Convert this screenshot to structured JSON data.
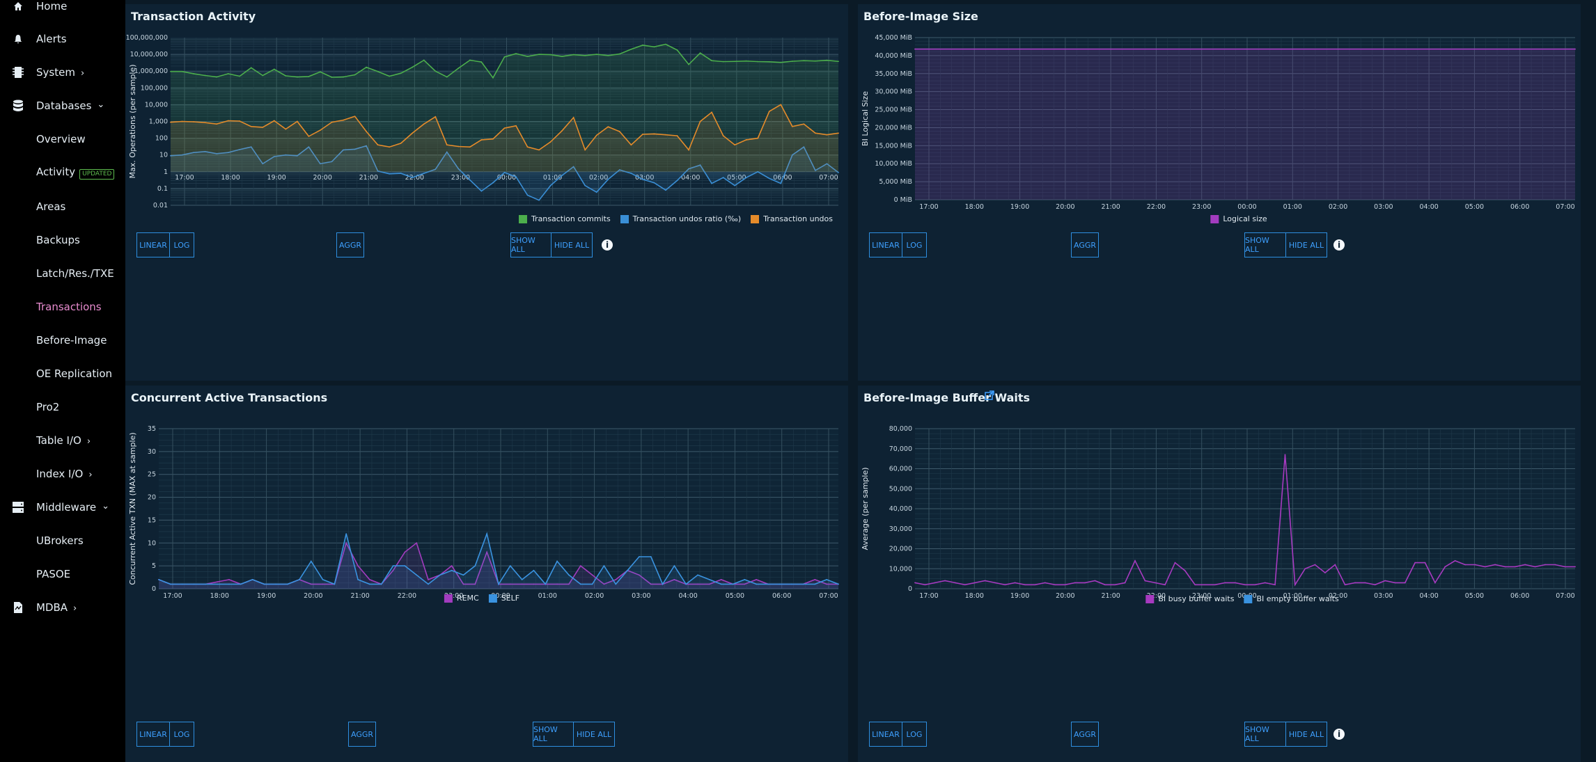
{
  "sidebar": {
    "items": [
      {
        "label": "Home",
        "icon": "home-icon",
        "chev": "",
        "active": false
      },
      {
        "label": "Alerts",
        "icon": "bell-icon",
        "chev": "",
        "active": false
      },
      {
        "label": "System",
        "icon": "chip-icon",
        "chev": "›",
        "active": false
      },
      {
        "label": "Databases",
        "icon": "database-icon",
        "chev": "⌄",
        "active": false
      },
      {
        "label": "Overview",
        "icon": "",
        "chev": "",
        "active": false
      },
      {
        "label": "Activity",
        "icon": "",
        "chev": "",
        "active": false,
        "badge": "UPDATED"
      },
      {
        "label": "Areas",
        "icon": "",
        "chev": "",
        "active": false
      },
      {
        "label": "Backups",
        "icon": "",
        "chev": "",
        "active": false
      },
      {
        "label": "Latch/Res./TXE",
        "icon": "",
        "chev": "",
        "active": false
      },
      {
        "label": "Transactions",
        "icon": "",
        "chev": "",
        "active": true
      },
      {
        "label": "Before-Image",
        "icon": "",
        "chev": "",
        "active": false
      },
      {
        "label": "OE Replication",
        "icon": "",
        "chev": "",
        "active": false
      },
      {
        "label": "Pro2",
        "icon": "",
        "chev": "",
        "active": false
      },
      {
        "label": "Table I/O",
        "icon": "",
        "chev": "›",
        "active": false
      },
      {
        "label": "Index I/O",
        "icon": "",
        "chev": "›",
        "active": false
      },
      {
        "label": "Middleware",
        "icon": "server-icon",
        "chev": "⌄",
        "active": false
      },
      {
        "label": "UBrokers",
        "icon": "",
        "chev": "",
        "active": false
      },
      {
        "label": "PASOE",
        "icon": "",
        "chev": "",
        "active": false
      },
      {
        "label": "MDBA",
        "icon": "document-icon",
        "chev": "›",
        "active": false
      }
    ]
  },
  "buttons": {
    "linear": "LINEAR",
    "log": "LOG",
    "aggr": "AGGR",
    "show_all": "SHOW ALL",
    "hide_all": "HIDE ALL",
    "info": "i"
  },
  "panels": {
    "transaction_activity": {
      "title": "Transaction Activity"
    },
    "bi_size": {
      "title": "Before-Image Size"
    },
    "concurrent": {
      "title": "Concurrent Active Transactions"
    },
    "bi_buffer_waits": {
      "title": "Before-Image Buffer Waits"
    }
  },
  "colors": {
    "green": "#4cae4c",
    "blue": "#3a8fd6",
    "orange": "#e58b2a",
    "purple": "#a23cbf",
    "blue2": "#3a93e0",
    "purple2": "#a73ac0"
  },
  "chart_data": [
    {
      "id": "transaction_activity",
      "type": "line",
      "title": "Transaction Activity",
      "ylabel": "Max. Operations (per sample)",
      "yscale": "log",
      "ylim": [
        0.01,
        100000000
      ],
      "y_ticks": [
        "100,000,000",
        "10,000,000",
        "1,000,000",
        "100,000",
        "10,000",
        "1,000",
        "100",
        "10",
        "1",
        "0.1",
        "0.01"
      ],
      "x_ticks": [
        "17:00",
        "18:00",
        "19:00",
        "20:00",
        "21:00",
        "22:00",
        "23:00",
        "00:00",
        "01:00",
        "02:00",
        "03:00",
        "04:00",
        "05:00",
        "06:00",
        "07:00"
      ],
      "grid": true,
      "legend": "bottom-right",
      "series": [
        {
          "name": "Transaction commits",
          "color": "#4cae4c",
          "values": [
            950000,
            950000,
            700000,
            550000,
            450000,
            700000,
            500000,
            1600000,
            550000,
            1300000,
            520000,
            450000,
            480000,
            900000,
            430000,
            450000,
            600000,
            1700000,
            950000,
            500000,
            750000,
            1700000,
            4500000,
            1000000,
            450000,
            1500000,
            4500000,
            3500000,
            400000,
            7000000,
            11000000,
            7500000,
            10000000,
            9500000,
            7500000,
            9500000,
            8500000,
            10000000,
            8500000,
            10500000,
            20000000,
            35000000,
            28000000,
            40000000,
            18000000,
            2500000,
            12000000,
            4200000,
            3700000,
            3800000,
            4000000,
            3700000,
            3600000,
            3300000,
            3900000,
            4200000,
            4000000,
            4400000,
            3800000
          ]
        },
        {
          "name": "Transaction undos ratio (‰)",
          "color": "#3a8fd6",
          "values": [
            9,
            10,
            14,
            16,
            12,
            14,
            21,
            30,
            3,
            8,
            10,
            9,
            30,
            3,
            4,
            20,
            22,
            35,
            1.1,
            0.75,
            0.8,
            0.45,
            0.8,
            1.4,
            15,
            1.5,
            0.32,
            0.07,
            0.22,
            0.9,
            0.5,
            0.04,
            0.02,
            0.15,
            0.6,
            2,
            0.15,
            0.06,
            0.35,
            1.3,
            0.8,
            0.35,
            0.22,
            0.08,
            0.3,
            1.5,
            2.5,
            0.2,
            0.45,
            0.15,
            0.45,
            1,
            0.4,
            0.2,
            10,
            30,
            1.2,
            3,
            0.9
          ]
        },
        {
          "name": "Transaction undos",
          "color": "#e58b2a",
          "values": [
            900,
            1000,
            950,
            850,
            700,
            1100,
            1050,
            500,
            450,
            1100,
            350,
            1000,
            130,
            300,
            900,
            1200,
            2000,
            250,
            40,
            30,
            50,
            200,
            700,
            1900,
            40,
            32,
            30,
            80,
            90,
            400,
            550,
            30,
            20,
            60,
            280,
            1700,
            20,
            150,
            480,
            250,
            40,
            170,
            180,
            160,
            140,
            20,
            1000,
            3500,
            140,
            40,
            80,
            100,
            4000,
            10000,
            500,
            700,
            200,
            160,
            200
          ]
        }
      ]
    },
    {
      "id": "bi_size",
      "type": "line",
      "title": "Before-Image Size",
      "ylabel": "BI Logical Size",
      "ylim": [
        0,
        45000
      ],
      "y_ticks": [
        "45,000 MiB",
        "40,000 MiB",
        "35,000 MiB",
        "30,000 MiB",
        "25,000 MiB",
        "20,000 MiB",
        "15,000 MiB",
        "10,000 MiB",
        "5,000 MiB",
        "0 MiB"
      ],
      "x_ticks": [
        "17:00",
        "18:00",
        "19:00",
        "20:00",
        "21:00",
        "22:00",
        "23:00",
        "00:00",
        "01:00",
        "02:00",
        "03:00",
        "04:00",
        "05:00",
        "06:00",
        "07:00"
      ],
      "grid": true,
      "legend": "bottom-right",
      "series": [
        {
          "name": "Logical size",
          "color": "#a23cbf",
          "values": [
            41800,
            41800
          ]
        }
      ]
    },
    {
      "id": "concurrent",
      "type": "line",
      "title": "Concurrent Active Transactions",
      "ylabel": "Concurrent Active TXN (MAX at sample)",
      "ylim": [
        0,
        35
      ],
      "y_ticks": [
        "35",
        "30",
        "25",
        "20",
        "15",
        "10",
        "5",
        "0"
      ],
      "x_ticks": [
        "17:00",
        "18:00",
        "19:00",
        "20:00",
        "21:00",
        "22:00",
        "23:00",
        "00:00",
        "01:00",
        "02:00",
        "03:00",
        "04:00",
        "05:00",
        "06:00",
        "07:00"
      ],
      "grid": true,
      "legend": "bottom-center",
      "series": [
        {
          "name": "REMC",
          "color": "#a23cbf",
          "values": [
            2,
            1,
            1,
            1,
            1,
            1.5,
            2,
            1,
            2,
            1,
            1,
            1,
            2,
            1,
            1,
            1,
            10,
            5,
            2,
            1,
            4,
            8,
            10,
            2,
            3,
            5,
            1,
            1,
            8,
            1,
            1,
            1,
            1,
            1,
            1,
            1,
            5,
            3,
            1,
            2,
            4,
            3,
            1,
            1,
            2,
            1,
            1,
            1,
            2,
            1,
            1,
            2,
            1,
            1,
            1,
            1,
            2,
            1,
            1
          ]
        },
        {
          "name": "SELF",
          "color": "#3a93e0",
          "values": [
            2,
            1,
            1,
            1,
            1,
            1,
            1,
            1,
            2,
            1,
            1,
            1,
            2,
            6,
            2,
            1,
            12,
            2,
            1,
            1,
            5,
            5,
            3,
            1,
            3,
            4,
            3,
            5,
            12,
            1,
            5,
            2,
            4,
            1,
            6,
            3,
            1,
            1,
            5,
            1,
            4,
            7,
            7,
            1,
            5,
            1,
            3,
            2,
            1,
            1,
            2,
            1,
            1,
            1,
            1,
            1,
            1,
            2,
            1
          ]
        }
      ]
    },
    {
      "id": "bi_buffer_waits",
      "type": "line",
      "title": "Before-Image Buffer Waits",
      "ylabel": "Average (per sample)",
      "ylim": [
        0,
        80000
      ],
      "y_ticks": [
        "80,000",
        "70,000",
        "60,000",
        "50,000",
        "40,000",
        "30,000",
        "20,000",
        "10,000",
        "0"
      ],
      "x_ticks": [
        "17:00",
        "18:00",
        "19:00",
        "20:00",
        "21:00",
        "22:00",
        "23:00",
        "00:00",
        "01:00",
        "02:00",
        "03:00",
        "04:00",
        "05:00",
        "06:00",
        "07:00"
      ],
      "grid": true,
      "legend": "bottom-center",
      "series": [
        {
          "name": "BI busy buffer waits",
          "color": "#a73ac0",
          "values": [
            3000,
            2000,
            3000,
            4000,
            3000,
            2000,
            3000,
            4000,
            3000,
            2000,
            3000,
            2000,
            2000,
            3000,
            2000,
            2000,
            3000,
            3000,
            4000,
            2000,
            2000,
            3000,
            14000,
            4000,
            3000,
            2000,
            13000,
            9000,
            2000,
            2000,
            2000,
            3000,
            3000,
            2000,
            2000,
            3000,
            2000,
            67000,
            2000,
            10000,
            12000,
            8000,
            12000,
            2000,
            3000,
            3000,
            2000,
            4000,
            3000,
            3000,
            13000,
            13000,
            3000,
            11000,
            14000,
            12000,
            12000,
            11000,
            12000,
            11000,
            11000,
            12000,
            11000,
            12000,
            12000,
            11000,
            11000
          ]
        },
        {
          "name": "BI empty buffer waits",
          "color": "#3a93e0",
          "values": []
        }
      ]
    }
  ]
}
